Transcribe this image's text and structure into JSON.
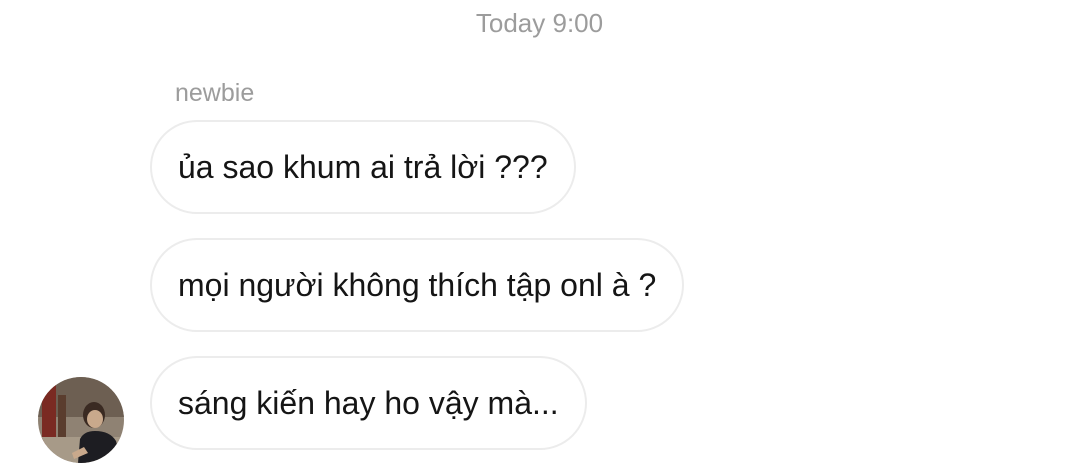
{
  "chat": {
    "timestamp": "Today 9:00",
    "sender_name": "newbie",
    "messages": [
      "ủa sao khum ai trả lời ???",
      "mọi người không thích tập onl à ?",
      "sáng kiến hay ho vậy mà..."
    ],
    "avatar": {
      "icon": "user-photo-avatar"
    }
  }
}
